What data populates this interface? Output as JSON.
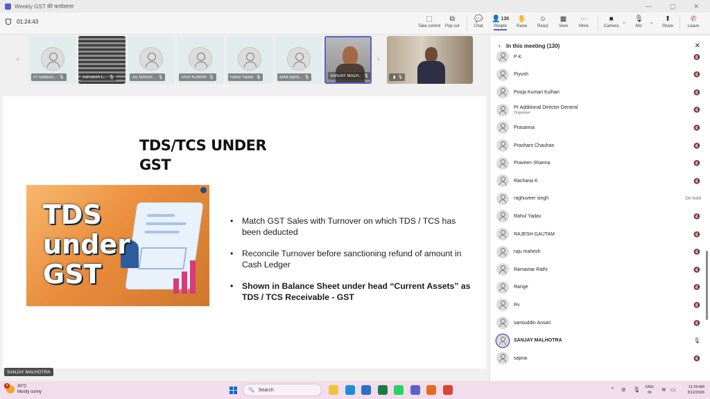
{
  "window": {
    "title": "Weekly GST की कार्यशाला"
  },
  "toolbar": {
    "timer": "01:24:43",
    "buttons": [
      {
        "label": "Take control",
        "icon": "take-control-icon",
        "glyph": "⬚"
      },
      {
        "label": "Pop out",
        "icon": "pop-out-icon",
        "glyph": "⧉"
      },
      {
        "label": "Chat",
        "icon": "chat-icon",
        "glyph": "💬"
      },
      {
        "label": "People",
        "icon": "people-icon",
        "glyph": "👤"
      },
      {
        "label": "Raise",
        "icon": "raise-hand-icon",
        "glyph": "✋"
      },
      {
        "label": "React",
        "icon": "react-icon",
        "glyph": "☺"
      },
      {
        "label": "View",
        "icon": "view-icon",
        "glyph": "▦"
      },
      {
        "label": "More",
        "icon": "more-icon",
        "glyph": "⋯"
      },
      {
        "label": "Camera",
        "icon": "camera-icon",
        "glyph": "■"
      },
      {
        "label": "Mic",
        "icon": "mic-off-icon",
        "glyph": "🎙"
      },
      {
        "label": "Share",
        "icon": "share-icon",
        "glyph": "⬆"
      },
      {
        "label": "Leave",
        "icon": "leave-icon",
        "glyph": "✆"
      }
    ],
    "people_count": "130"
  },
  "video_strip": {
    "tiles": [
      {
        "name": "Pr Addition...",
        "type": "avatar"
      },
      {
        "name": "Ashutosh L...",
        "type": "blinds"
      },
      {
        "name": "JAI NARAY...",
        "type": "avatar"
      },
      {
        "name": "SASI KUMAR",
        "type": "avatar"
      },
      {
        "name": "Rahul Yadav",
        "type": "avatar"
      },
      {
        "name": "ankit band...",
        "type": "avatar"
      },
      {
        "name": "SANJAY MALH...",
        "type": "video"
      },
      {
        "name": "",
        "type": "big"
      }
    ]
  },
  "slide": {
    "title_line1": "TDS/TCS UNDER",
    "title_line2": "GST",
    "image_text": [
      "TDS",
      "under",
      "GST"
    ],
    "bullets": [
      {
        "text": "Match GST Sales with Turnover on which TDS / TCS has been deducted",
        "bold": false
      },
      {
        "text": "Reconcile Turnover before sanctioning refund of amount in Cash Ledger",
        "bold": false
      },
      {
        "text": "Shown in Balance Sheet under head “Current Assets” as TDS / TCS Receivable - GST",
        "bold": true
      }
    ]
  },
  "speaker_label": "SANJAY MALHOTRA",
  "panel": {
    "title": "In this meeting (130)",
    "participants": [
      {
        "name": "P K",
        "role": "",
        "status": "muted"
      },
      {
        "name": "Piyush",
        "role": "",
        "status": "muted"
      },
      {
        "name": "Pooja Kumari Kulhari",
        "role": "",
        "status": "muted"
      },
      {
        "name": "Pr Additional Director General",
        "role": "Organizer",
        "status": "muted"
      },
      {
        "name": "Prasanna",
        "role": "",
        "status": "muted"
      },
      {
        "name": "Prashant Chauhan",
        "role": "",
        "status": "muted"
      },
      {
        "name": "Praveen Sharma",
        "role": "",
        "status": "muted"
      },
      {
        "name": "Rachana K",
        "role": "",
        "status": "muted"
      },
      {
        "name": "raghuveer singh",
        "role": "",
        "status": "On hold"
      },
      {
        "name": "Rahul Yadav",
        "role": "",
        "status": "muted"
      },
      {
        "name": "RAJESH GAUTAM",
        "role": "",
        "status": "muted"
      },
      {
        "name": "raju mahesh",
        "role": "",
        "status": "muted"
      },
      {
        "name": "Ramavtar Rathi",
        "role": "",
        "status": "muted"
      },
      {
        "name": "Range",
        "role": "",
        "status": "muted"
      },
      {
        "name": "Rv",
        "role": "",
        "status": "muted"
      },
      {
        "name": "samiuddin Ansari",
        "role": "",
        "status": "muted"
      },
      {
        "name": "SANJAY MALHOTRA",
        "role": "",
        "status": "speaking"
      },
      {
        "name": "sapna",
        "role": "",
        "status": "muted"
      }
    ]
  },
  "taskbar": {
    "weather_temp": "30°C",
    "weather_desc": "Mostly sunny",
    "notification_count": "4",
    "search_placeholder": "Search",
    "lang_line1": "ENG",
    "lang_line2": "IN",
    "time": "11:39 AM",
    "date": "3/12/2026",
    "pinned_apps": [
      {
        "name": "file-explorer-icon",
        "color": "#f4c242"
      },
      {
        "name": "edge-icon",
        "color": "#1b8fd6"
      },
      {
        "name": "store-icon",
        "color": "#2b6fce"
      },
      {
        "name": "excel-icon",
        "color": "#1d7a43"
      },
      {
        "name": "whatsapp-icon",
        "color": "#25d366"
      },
      {
        "name": "teams-icon",
        "color": "#5b5fc7"
      },
      {
        "name": "firefox-icon",
        "color": "#e66a1f"
      },
      {
        "name": "chrome-icon",
        "color": "#db4437"
      }
    ]
  },
  "colors": {
    "accent": "#5b5fc7",
    "leave": "#c4314b",
    "taskbar": "#f1ddeb"
  }
}
